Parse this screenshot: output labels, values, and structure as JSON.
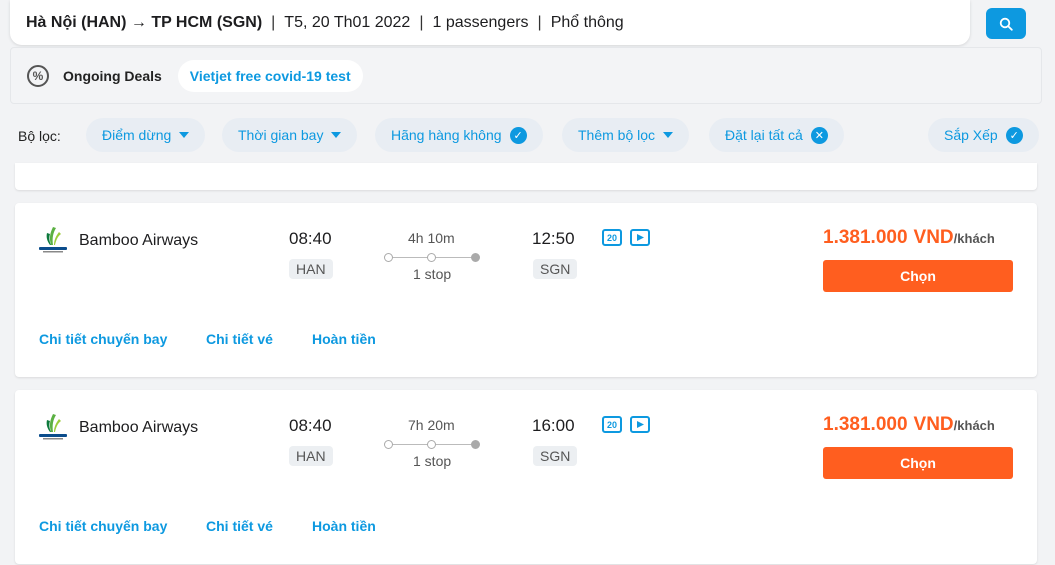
{
  "search": {
    "route": "Hà Nội (HAN) → TP HCM (SGN)",
    "date": "T5, 20 Th01 2022",
    "passengers": "1 passengers",
    "cabin": "Phổ thông",
    "separator": "|"
  },
  "deals": {
    "icon": "percent-icon",
    "label": "Ongoing Deals",
    "chip": "Vietjet free covid-19 test"
  },
  "filters": {
    "title": "Bộ lọc:",
    "stops": "Điểm dừng",
    "flight_time": "Thời gian bay",
    "airlines": "Hãng hàng không",
    "more": "Thêm bộ lọc",
    "reset": "Đặt lại tất cả",
    "sort": "Sắp Xếp"
  },
  "flights": [
    {
      "airline": "Bamboo Airways",
      "dep_time": "08:40",
      "dep_code": "HAN",
      "duration": "4h 10m",
      "stops": "1 stop",
      "arr_time": "12:50",
      "arr_code": "SGN",
      "amenity_baggage": "20",
      "price": "1.381.000",
      "currency": "VND",
      "unit": "/khách",
      "select": "Chọn",
      "links": [
        "Chi tiết chuyến bay",
        "Chi tiết vé",
        "Hoàn tiền"
      ]
    },
    {
      "airline": "Bamboo Airways",
      "dep_time": "08:40",
      "dep_code": "HAN",
      "duration": "7h 20m",
      "stops": "1 stop",
      "arr_time": "16:00",
      "arr_code": "SGN",
      "amenity_baggage": "20",
      "price": "1.381.000",
      "currency": "VND",
      "unit": "/khách",
      "select": "Chọn",
      "links": [
        "Chi tiết chuyến bay",
        "Chi tiết vé",
        "Hoàn tiền"
      ]
    }
  ],
  "colors": {
    "accent": "#0d99e0",
    "price": "#ff5e1f",
    "button": "#ff5e1f"
  }
}
